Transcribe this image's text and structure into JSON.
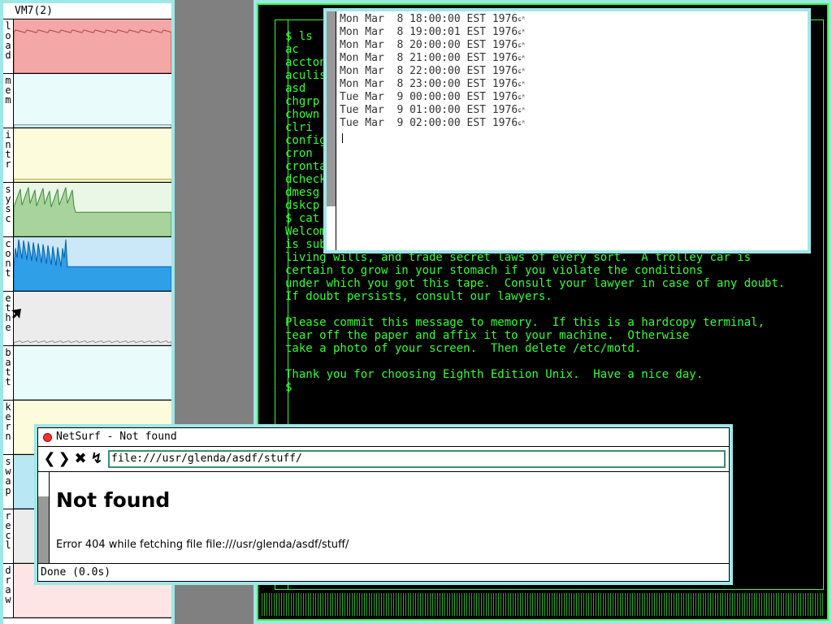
{
  "stats": {
    "title": "VM7(2)",
    "rows": [
      {
        "label": "load",
        "color": "#f4a7a7",
        "line": "#b04040",
        "level": 0.78
      },
      {
        "label": "mem",
        "color": "#e9fbfb",
        "line": "#5a8a8a",
        "level": 0.05
      },
      {
        "label": "intr",
        "color": "#fcfbdc",
        "line": "#a0a040",
        "level": 0.05
      },
      {
        "label": "sysc",
        "color": "#a9d39c",
        "line": "#3a8a3a",
        "level": 0.45
      },
      {
        "label": "cont",
        "color": "#2f9fe8",
        "line": "#0060b0",
        "level": 0.45
      },
      {
        "label": "ethe",
        "color": "#ececec",
        "line": "#909090",
        "level": 0.05
      },
      {
        "label": "batt",
        "color": "#e9fbfb",
        "line": "#5a8a8a",
        "level": 0.0
      },
      {
        "label": "kern",
        "color": "#fcfbdc",
        "line": "#a0a040",
        "level": 0.0
      },
      {
        "label": "swap",
        "color": "#b9e7f3",
        "line": "#4080a0",
        "level": 0.0
      },
      {
        "label": "recl",
        "color": "#ececec",
        "line": "#909090",
        "level": 0.0
      },
      {
        "label": "draw",
        "color": "#fde5e5",
        "line": "#c08080",
        "level": 0.0
      }
    ]
  },
  "terminal": {
    "lines": [
      "$ ls",
      "ac",
      "accton",
      "aculist",
      "asd",
      "chgrp",
      "chown",
      "clri",
      "config",
      "cron",
      "crontab",
      "dcheck",
      "dmesg",
      "dskcp",
      "$ cat /etc/motd",
      "Welcome to Eighth Edition Unix.  This software",
      "is subject to trade secret, copyright, patent,",
      "living wills, and trade secret laws of every sort.  A trolley car is",
      "certain to grow in your stomach if you violate the conditions",
      "under which you got this tape.  Consult your lawyer in case of any doubt.",
      "If doubt persists, consult our lawyers.",
      "",
      "Please commit this message to memory.  If this is a hardcopy terminal,",
      "tear off the paper and affix it to your machine.  Otherwise",
      "take a photo of your screen.  Then delete /etc/motd.",
      "",
      "Thank you for choosing Eighth Edition Unix.  Have a nice day.",
      "$"
    ]
  },
  "datewin": {
    "lines": [
      "Mon Mar  8 18:00:00 EST 1976",
      "Mon Mar  8 19:00:01 EST 1976",
      "Mon Mar  8 20:00:00 EST 1976",
      "Mon Mar  8 21:00:00 EST 1976",
      "Mon Mar  8 22:00:00 EST 1976",
      "Mon Mar  8 23:00:00 EST 1976",
      "Tue Mar  9 00:00:00 EST 1976",
      "Tue Mar  9 01:00:00 EST 1976",
      "Tue Mar  9 02:00:00 EST 1976"
    ],
    "cr_glyph": "ɕᴿ"
  },
  "netsurf": {
    "title": "NetSurf - Not found",
    "url": "file:///usr/glenda/asdf/stuff/",
    "heading": "Not found",
    "error": "Error 404 while fetching file file:///usr/glenda/asdf/stuff/",
    "status": "Done (0.0s)",
    "buttons": {
      "back": "❮",
      "forward": "❯",
      "stop": "✖",
      "reload": "↯"
    }
  }
}
